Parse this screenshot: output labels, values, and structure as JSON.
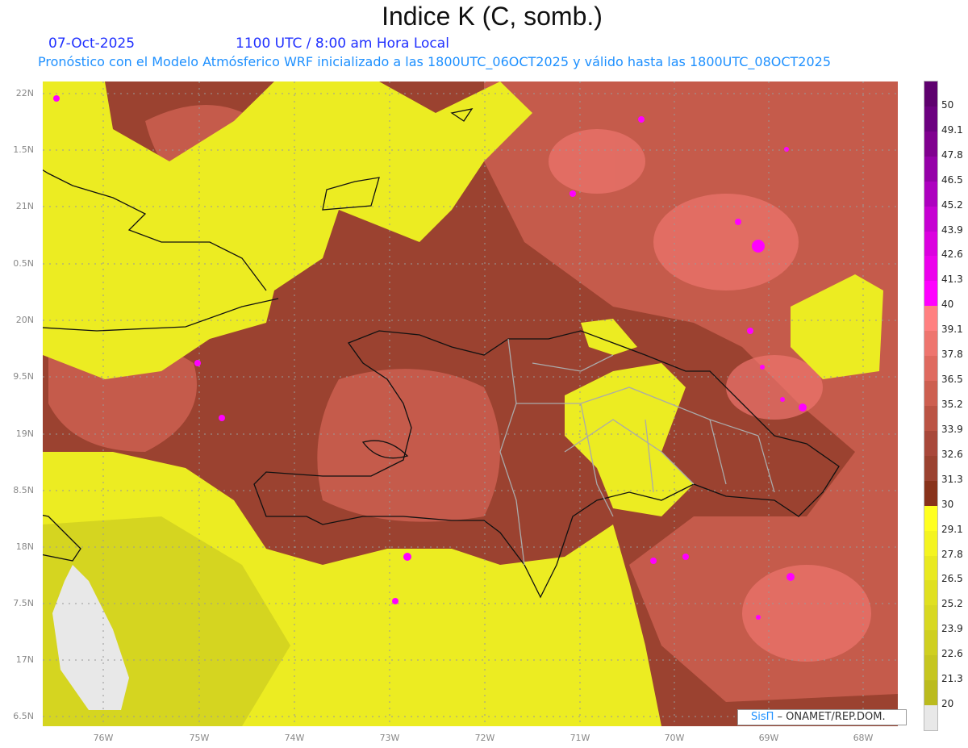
{
  "header": {
    "title": "Indice K (C, somb.)",
    "date": "07-Oct-2025",
    "time": "1100 UTC / 8:00 am Hora Local",
    "subtitle": "Pronóstico con el Modelo Atmósferico WRF inicializado a las 1800UTC_06OCT2025 y válido hasta las  1800UTC_08OCT2025"
  },
  "axes": {
    "lat_labels": [
      "22N",
      "1.5N",
      "21N",
      "0.5N",
      "20N",
      "9.5N",
      "19N",
      "8.5N",
      "18N",
      "7.5N",
      "17N",
      "6.5N"
    ],
    "lon_labels": [
      "76W",
      "75W",
      "74W",
      "73W",
      "72W",
      "71W",
      "70W",
      "69W",
      "68W"
    ]
  },
  "colorbar": {
    "labels": [
      "50",
      "49.1",
      "47.8",
      "46.5",
      "45.2",
      "43.9",
      "42.6",
      "41.3",
      "40",
      "39.1",
      "37.8",
      "36.5",
      "35.2",
      "33.9",
      "32.6",
      "31.3",
      "30",
      "29.1",
      "27.8",
      "26.5",
      "25.2",
      "23.9",
      "22.6",
      "21.3",
      "20"
    ],
    "colors": [
      "#5e006e",
      "#6c0080",
      "#80008f",
      "#9500a8",
      "#ad00bf",
      "#c600d2",
      "#db00df",
      "#ec00ec",
      "#ff00ff",
      "#ff8080",
      "#ee756e",
      "#df6a5f",
      "#cd5f50",
      "#bb5444",
      "#a8483a",
      "#9b4230",
      "#88321a",
      "#ffff20",
      "#f4f420",
      "#e9e920",
      "#e0e020",
      "#d8d821",
      "#cfcf20",
      "#c6c620",
      "#bbbb1e",
      "#e8e8e8"
    ]
  },
  "credit": {
    "brand": "SisΠ",
    "text": " –  ONAMET/REP.DOM."
  }
}
